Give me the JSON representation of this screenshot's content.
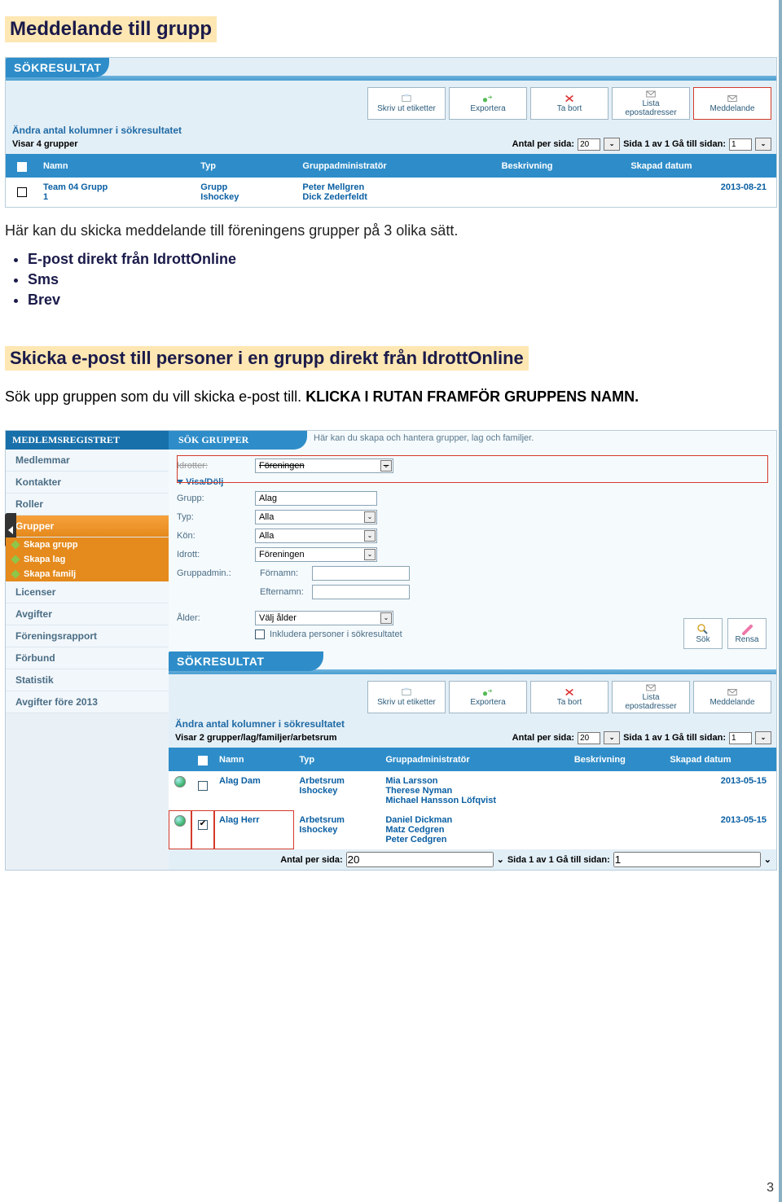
{
  "page": {
    "number": "3"
  },
  "heading1": "Meddelande till grupp",
  "intro": "Här kan du skicka meddelande till föreningens grupper på 3 olika sätt.",
  "bullets": [
    "E-post direkt från IdrottOnline",
    "Sms",
    "Brev"
  ],
  "heading2": "Skicka e-post till personer i en grupp direkt från IdrottOnline",
  "instr_a": "Sök upp gruppen som du vill skicka e-post till. ",
  "instr_b": "KLICKA I RUTAN FRAMFÖR GRUPPENS NAMN.",
  "panel1": {
    "title": "SÖKRESULTAT",
    "toolbar": {
      "skriv": "Skriv ut etiketter",
      "exportera": "Exportera",
      "tabort": "Ta bort",
      "lista": "Lista epostadresser",
      "meddelande": "Meddelande"
    },
    "cols_link": "Ändra antal kolumner i sökresultatet",
    "visar": "Visar 4 grupper",
    "pager": {
      "antal_lbl": "Antal per sida:",
      "antal_val": "20",
      "sidetext": "Sida 1 av 1  Gå till sidan:",
      "page_val": "1"
    },
    "headers": [
      "",
      "Namn",
      "Typ",
      "Gruppadministratör",
      "Beskrivning",
      "Skapad datum"
    ],
    "row": {
      "namn_l1": "Team 04 Grupp",
      "namn_l2": "1",
      "typ_l1": "Grupp",
      "typ_l2": "Ishockey",
      "admin_l1": "Peter Mellgren",
      "admin_l2": "Dick Zederfeldt",
      "beskr": "",
      "date": "2013-08-21"
    }
  },
  "panel2": {
    "side_head": "MEDLEMSREGISTRET",
    "side_items": [
      "Medlemmar",
      "Kontakter",
      "Roller"
    ],
    "side_active": "Grupper",
    "side_subs": [
      "Skapa grupp",
      "Skapa lag",
      "Skapa familj"
    ],
    "side_items2": [
      "Licenser",
      "Avgifter",
      "Föreningsrapport",
      "Förbund",
      "Statistik",
      "Avgifter före 2013"
    ],
    "main_head": "SÖK GRUPPER",
    "main_desc": "Här kan du skapa och hantera grupper, lag och familjer.",
    "form": {
      "idrotter_lbl": "Idrotter:",
      "idrotter_val": "Föreningen",
      "visa_lbl": "Visa/Dölj",
      "grupp_lbl": "Grupp:",
      "grupp_val": "Alag",
      "typ_lbl": "Typ:",
      "typ_val": "Alla",
      "kon_lbl": "Kön:",
      "kon_val": "Alla",
      "idrott_lbl": "Idrott:",
      "idrott_val": "Föreningen",
      "grpadm_lbl": "Gruppadmin.:",
      "fornamn_lbl": "Förnamn:",
      "efternamn_lbl": "Efternamn:",
      "alder_lbl": "Ålder:",
      "alder_val": "Välj ålder",
      "inkludera_lbl": "Inkludera personer i sökresultatet"
    },
    "actions": {
      "sok": "Sök",
      "rensa": "Rensa"
    },
    "result_title": "SÖKRESULTAT",
    "toolbar": {
      "skriv": "Skriv ut etiketter",
      "exportera": "Exportera",
      "tabort": "Ta bort",
      "lista": "Lista epostadresser",
      "meddelande": "Meddelande"
    },
    "cols_link": "Ändra antal kolumner i sökresultatet",
    "visar": "Visar 2 grupper/lag/familjer/arbetsrum",
    "pager": {
      "antal_lbl": "Antal per sida:",
      "antal_val": "20",
      "sidetext": "Sida 1 av 1  Gå till sidan:",
      "page_val": "1"
    },
    "headers": [
      "",
      "",
      "Namn",
      "Typ",
      "Gruppadministratör",
      "Beskrivning",
      "Skapad datum"
    ],
    "rows": [
      {
        "namn": "Alag Dam",
        "typ_l1": "Arbetsrum",
        "typ_l2": "Ishockey",
        "admins": [
          "Mia Larsson",
          "Therese Nyman",
          "Michael Hansson Löfqvist"
        ],
        "date": "2013-05-15",
        "checked": false,
        "highlighted": false
      },
      {
        "namn": "Alag Herr",
        "typ_l1": "Arbetsrum",
        "typ_l2": "Ishockey",
        "admins": [
          "Daniel Dickman",
          "Matz Cedgren",
          "Peter Cedgren"
        ],
        "date": "2013-05-15",
        "checked": true,
        "highlighted": true
      }
    ]
  }
}
